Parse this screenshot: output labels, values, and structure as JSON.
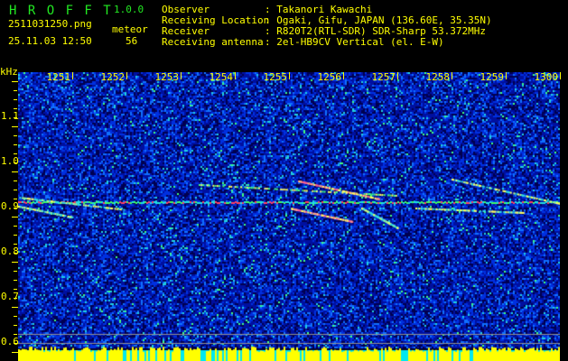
{
  "app": {
    "name": "H R O F F T",
    "version": "1.0.0"
  },
  "file": {
    "name": "2511031250.png",
    "datetime": "25.11.03 12:50"
  },
  "count": {
    "label": "meteor",
    "value": "56"
  },
  "info": [
    {
      "label": "Observer",
      "value": ": Takanori Kawachi"
    },
    {
      "label": "Receiving Location",
      "value": ": Ogaki, Gifu, JAPAN (136.60E, 35.35N)"
    },
    {
      "label": "Receiver",
      "value": ": R820T2(RTL-SDR) SDR-Sharp 53.372MHz"
    },
    {
      "label": "Receiving antenna",
      "value": ": 2el-HB9CV Vertical (el. E-W)"
    }
  ],
  "axis": {
    "y_unit": "kHz",
    "x_ticks": [
      "1251",
      "1252",
      "1253",
      "1254",
      "1255",
      "1256",
      "1257",
      "1258",
      "1259",
      "1300"
    ],
    "y_ticks": [
      "1.1",
      "1.0",
      "0.9",
      "0.8",
      "0.7",
      "0.6"
    ]
  },
  "colors": {
    "label": "#ffff00",
    "title": "#22e822",
    "background": "#000000"
  }
}
